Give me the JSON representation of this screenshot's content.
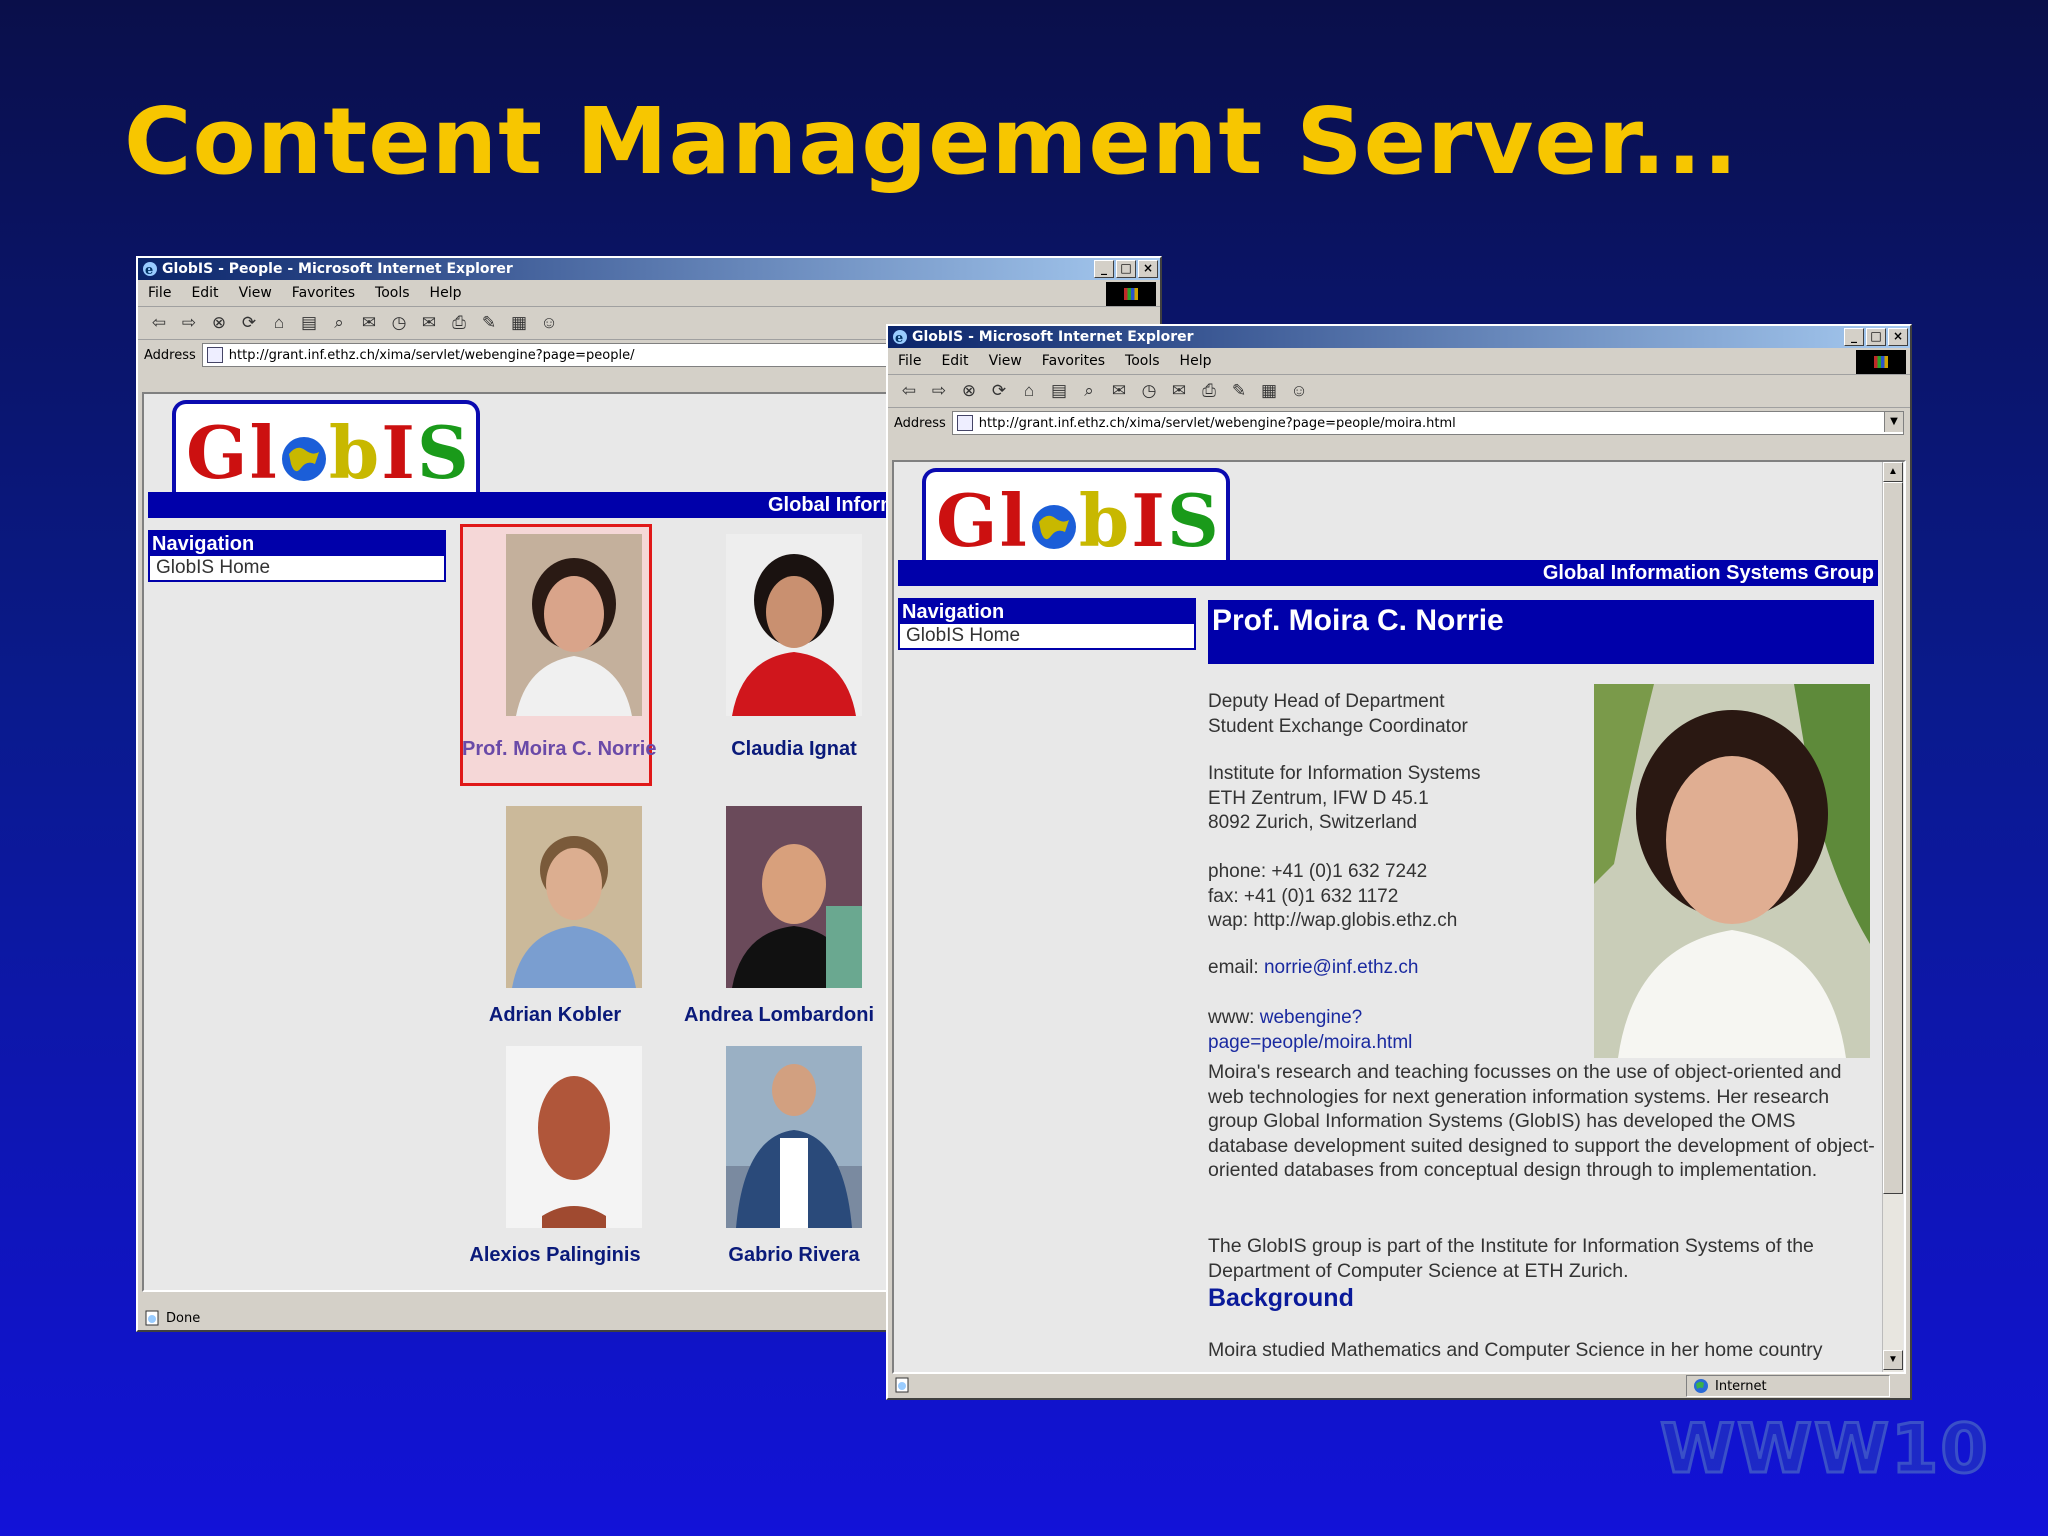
{
  "slide": {
    "title": "Content Management Server...",
    "watermark": "WWW10"
  },
  "menu": [
    "File",
    "Edit",
    "View",
    "Favorites",
    "Tools",
    "Help"
  ],
  "address_label": "Address",
  "window_people": {
    "title": "GlobIS - People - Microsoft Internet Explorer",
    "url": "http://grant.inf.ethz.ch/xima/servlet/webengine?page=people/",
    "banner": "Global Information Systems Group",
    "status": "Done",
    "people": [
      "Prof. Moira C. Norrie",
      "Claudia Ignat",
      "Adrian Kobler",
      "Andrea Lombardoni",
      "Alexios Palinginis",
      "Gabrio Rivera"
    ]
  },
  "window_profile": {
    "title": "GlobIS - Microsoft Internet Explorer",
    "url": "http://grant.inf.ethz.ch/xima/servlet/webengine?page=people/moira.html",
    "banner": "Global Information Systems Group",
    "heading": "Prof. Moira C. Norrie",
    "role1": "Deputy Head of Department",
    "role2": "Student Exchange Coordinator",
    "inst1": "Institute for Information Systems",
    "inst2": "ETH Zentrum, IFW D 45.1",
    "inst3": "8092 Zurich, Switzerland",
    "phone": "phone: +41 (0)1 632 7242",
    "fax": "fax: +41 (0)1 632 1172",
    "wap": "wap: http://wap.globis.ethz.ch",
    "email_label": "email: ",
    "email": "norrie@inf.ethz.ch",
    "www_label": "www: ",
    "www1": "webengine?",
    "www2": "page=people/moira.html",
    "para1": "Moira's research and teaching focusses on the use of object-oriented and web technologies for next generation information systems. Her research group Global Information Systems (GlobIS) has developed the OMS database development suited designed to support the development of object-oriented databases from conceptual design through to implementation.",
    "para2": "The GlobIS group is part of the Institute for Information Systems of the Department of Computer Science at ETH Zurich.",
    "background_heading": "Background",
    "para3": "Moira studied Mathematics and Computer Science in her home country",
    "status_zone": "Internet"
  },
  "nav": {
    "heading": "Navigation",
    "home": "GlobIS Home"
  },
  "logo": {
    "g": "G",
    "l": "l",
    "b": "b",
    "i": "I",
    "s": "S"
  },
  "colors": {
    "title": "#f7c600",
    "nav_blue": "#0000aa",
    "link": "#1a2aa0"
  }
}
